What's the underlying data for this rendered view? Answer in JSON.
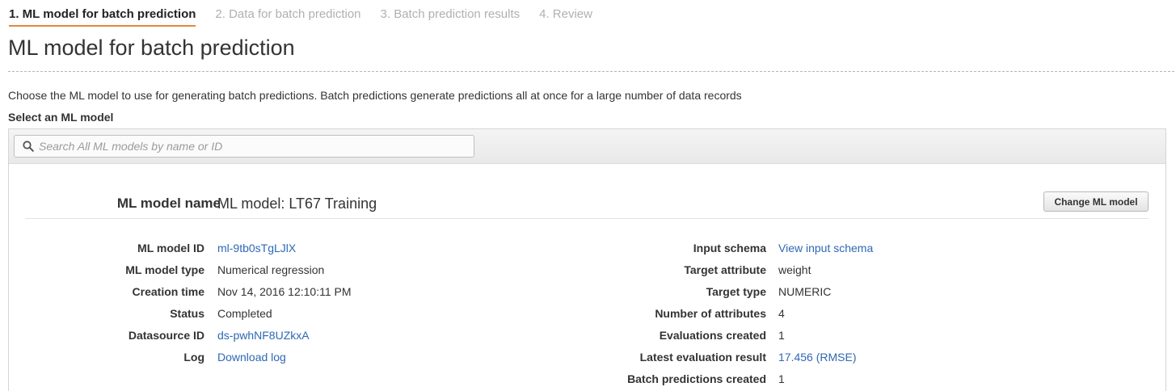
{
  "steps": [
    {
      "label": "1. ML model for batch prediction",
      "active": true
    },
    {
      "label": "2. Data for batch prediction",
      "active": false
    },
    {
      "label": "3. Batch prediction results",
      "active": false
    },
    {
      "label": "4. Review",
      "active": false
    }
  ],
  "page_title": "ML model for batch prediction",
  "description": "Choose the ML model to use for generating batch predictions. Batch predictions generate predictions all at once for a large number of data records",
  "select_label": "Select an ML model",
  "search": {
    "placeholder": "Search All ML models by name or ID",
    "icon": "search-icon"
  },
  "model": {
    "name_label": "ML model name",
    "name_value": "ML model: LT67 Training",
    "change_button": "Change ML model"
  },
  "left_details": [
    {
      "label": "ML model ID",
      "value": "ml-9tb0sTgLJlX",
      "link": true
    },
    {
      "label": "ML model type",
      "value": "Numerical regression",
      "link": false
    },
    {
      "label": "Creation time",
      "value": "Nov 14, 2016 12:10:11 PM",
      "link": false
    },
    {
      "label": "Status",
      "value": "Completed",
      "link": false
    },
    {
      "label": "Datasource ID",
      "value": "ds-pwhNF8UZkxA",
      "link": true
    },
    {
      "label": "Log",
      "value": "Download log",
      "link": true
    }
  ],
  "right_details": [
    {
      "label": "Input schema",
      "value": "View input schema",
      "link": true
    },
    {
      "label": "Target attribute",
      "value": "weight",
      "link": false
    },
    {
      "label": "Target type",
      "value": "NUMERIC",
      "link": false
    },
    {
      "label": "Number of attributes",
      "value": "4",
      "link": false
    },
    {
      "label": "Evaluations created",
      "value": "1",
      "link": false
    },
    {
      "label": "Latest evaluation result",
      "value": "17.456 (RMSE)",
      "link": true
    },
    {
      "label": "Batch predictions created",
      "value": "1",
      "link": false
    }
  ],
  "colors": {
    "accent": "#e08a3c",
    "link": "#2f68b4"
  }
}
